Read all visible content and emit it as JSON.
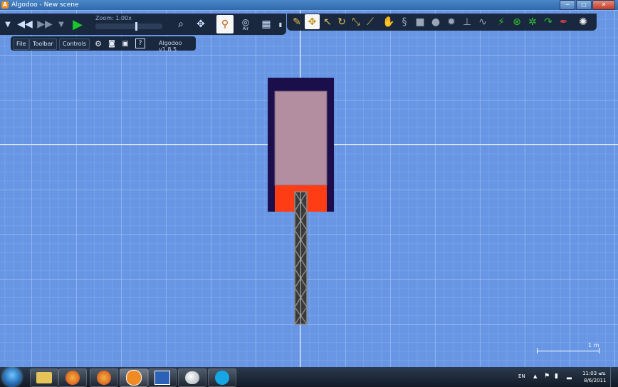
{
  "window": {
    "title": "Algodoo - New scene",
    "app_icon": "A",
    "minimize": "─",
    "maximize": "□",
    "close": "✕"
  },
  "toolbar": {
    "zoom_label": "Zoom: 1.00x",
    "air_label": "Air",
    "zoom_level": 0.62
  },
  "menu": {
    "file": "File",
    "toolbar": "Toolbar",
    "controls": "Controls",
    "version": "Algodoo v1.8.5"
  },
  "scene": {
    "scale_label": "1 m"
  },
  "taskbar": {
    "language": "EN",
    "time": "11:03 ๗น",
    "date": "8/6/2011"
  },
  "colors": {
    "canvas": "#6896e4",
    "container_border": "#1a0f4a",
    "liquid_top": "#b38ea0",
    "liquid_bottom": "#ff3d14",
    "piston": "#3a3a3a"
  }
}
